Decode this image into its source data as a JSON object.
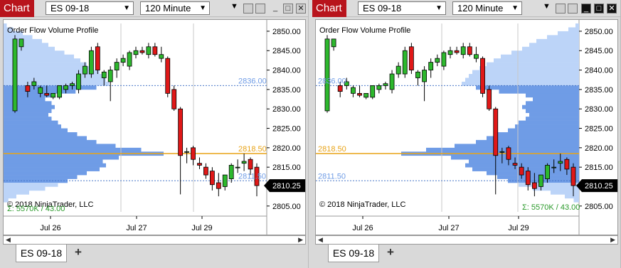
{
  "windows": [
    {
      "title": "Chart",
      "instrument": "ES 09-18",
      "interval": "120 Minute",
      "indicator_label": "Order Flow Volume Profile",
      "copyright": "© 2018 NinjaTrader, LLC",
      "sigma": "Σ: 5570K / 43.00",
      "price_axis": [
        "2850.00",
        "2845.00",
        "2840.00",
        "2835.00",
        "2830.00",
        "2825.00",
        "2820.00",
        "2815.00",
        "2810.00",
        "2805.00"
      ],
      "level_labels": {
        "high": "2836.00",
        "poc": "2818.50",
        "low": "2811.50"
      },
      "last_price": "2810.25",
      "time_labels": [
        "Jul 26",
        "Jul 27",
        "Jul 29"
      ],
      "tab": "ES 09-18",
      "maximized": false
    },
    {
      "title": "Chart",
      "instrument": "ES 09-18",
      "interval": "120 Minute",
      "indicator_label": "Order Flow Volume Profile",
      "copyright": "© 2018 NinjaTrader, LLC",
      "sigma": "Σ: 5570K / 43.00",
      "price_axis": [
        "2850.00",
        "2845.00",
        "2840.00",
        "2835.00",
        "2830.00",
        "2825.00",
        "2820.00",
        "2815.00",
        "2810.00",
        "2805.00"
      ],
      "level_labels": {
        "high": "2836.00",
        "poc": "2818.50",
        "low": "2811.50"
      },
      "last_price": "2810.25",
      "time_labels": [
        "Jul 26",
        "Jul 27",
        "Jul 29"
      ],
      "tab": "ES 09-18",
      "maximized": true
    }
  ],
  "chart_data": {
    "type": "candlestick",
    "y_range": [
      2803.5,
      2852
    ],
    "value_area": [
      2811.5,
      2836.0
    ],
    "poc": 2818.5,
    "last": 2810.25,
    "candles": [
      [
        2829.5,
        2849,
        2829,
        2848
      ],
      [
        2846,
        2848,
        2845,
        2848
      ],
      [
        2836,
        2837,
        2833,
        2834.5
      ],
      [
        2836,
        2838,
        2835,
        2837
      ],
      [
        2834,
        2836,
        2833,
        2835.5
      ],
      [
        2834,
        2836,
        2833,
        2833.5
      ],
      [
        2833,
        2834,
        2832.5,
        2834
      ],
      [
        2833,
        2836,
        2832.5,
        2836
      ],
      [
        2835,
        2836.5,
        2834,
        2836
      ],
      [
        2836,
        2837,
        2835,
        2836.5
      ],
      [
        2835,
        2840,
        2834,
        2839
      ],
      [
        2839,
        2842,
        2838,
        2841
      ],
      [
        2839,
        2846,
        2838,
        2845
      ],
      [
        2846,
        2847,
        2839,
        2840
      ],
      [
        2838,
        2840,
        2836,
        2839.5
      ],
      [
        2837,
        2841,
        2832,
        2840
      ],
      [
        2840,
        2843,
        2838,
        2842
      ],
      [
        2842,
        2844,
        2841,
        2843
      ],
      [
        2841,
        2845,
        2840,
        2844.5
      ],
      [
        2844,
        2846,
        2843,
        2845
      ],
      [
        2845,
        2846,
        2844,
        2844.5
      ],
      [
        2844,
        2847,
        2843,
        2846
      ],
      [
        2846,
        2847,
        2843.5,
        2844
      ],
      [
        2843,
        2846,
        2842,
        2844
      ],
      [
        2843,
        2843.5,
        2833,
        2834
      ],
      [
        2835,
        2836,
        2829.5,
        2830
      ],
      [
        2830,
        2830.5,
        2808,
        2818
      ],
      [
        2819,
        2820,
        2816,
        2819
      ],
      [
        2820,
        2820.5,
        2815.5,
        2817
      ],
      [
        2816,
        2817.5,
        2814.5,
        2815.5
      ],
      [
        2815,
        2816,
        2812,
        2813
      ],
      [
        2814,
        2815,
        2809,
        2810.5
      ],
      [
        2811,
        2813.5,
        2807.5,
        2809.5
      ],
      [
        2810,
        2813,
        2809,
        2813
      ],
      [
        2812,
        2816,
        2811,
        2815.5
      ],
      [
        2815,
        2817,
        2813.5,
        2815
      ],
      [
        2816,
        2818.5,
        2814,
        2816.5
      ],
      [
        2817,
        2817.5,
        2813,
        2814.5
      ],
      [
        2815,
        2816,
        2807.5,
        2810.25
      ]
    ],
    "profile": [
      [
        2851.5,
        0.02
      ],
      [
        2850.5,
        0.06
      ],
      [
        2849.5,
        0.12
      ],
      [
        2848.5,
        0.18
      ],
      [
        2847.5,
        0.24
      ],
      [
        2846.5,
        0.28
      ],
      [
        2845.5,
        0.32
      ],
      [
        2844.5,
        0.38
      ],
      [
        2843.5,
        0.44
      ],
      [
        2842.5,
        0.48
      ],
      [
        2841.5,
        0.52
      ],
      [
        2840.5,
        0.56
      ],
      [
        2839.5,
        0.6
      ],
      [
        2838.5,
        0.62
      ],
      [
        2837.5,
        0.64
      ],
      [
        2836.5,
        0.66
      ],
      [
        2835.5,
        0.58
      ],
      [
        2834.5,
        0.45
      ],
      [
        2833.5,
        0.3
      ],
      [
        2832.5,
        0.26
      ],
      [
        2831.5,
        0.3
      ],
      [
        2830.5,
        0.32
      ],
      [
        2829.5,
        0.3
      ],
      [
        2828.5,
        0.28
      ],
      [
        2827.5,
        0.3
      ],
      [
        2826.5,
        0.34
      ],
      [
        2825.5,
        0.36
      ],
      [
        2824.5,
        0.4
      ],
      [
        2823.5,
        0.46
      ],
      [
        2822.5,
        0.52
      ],
      [
        2821.5,
        0.58
      ],
      [
        2820.5,
        0.7
      ],
      [
        2819.5,
        0.86
      ],
      [
        2818.5,
        1.0
      ],
      [
        2817.5,
        0.72
      ],
      [
        2816.5,
        0.62
      ],
      [
        2815.5,
        0.64
      ],
      [
        2814.5,
        0.6
      ],
      [
        2813.5,
        0.52
      ],
      [
        2812.5,
        0.46
      ],
      [
        2811.5,
        0.4
      ],
      [
        2810.5,
        0.34
      ],
      [
        2809.5,
        0.26
      ],
      [
        2808.5,
        0.16
      ],
      [
        2807.5,
        0.08
      ],
      [
        2806.5,
        0.03
      ]
    ],
    "colors": {
      "up": "#2db82d",
      "down": "#e01818",
      "va": "#6f9ce6",
      "outside": "#bcd4f8",
      "poc": "#e8a317",
      "level": "#4a78c8"
    }
  }
}
